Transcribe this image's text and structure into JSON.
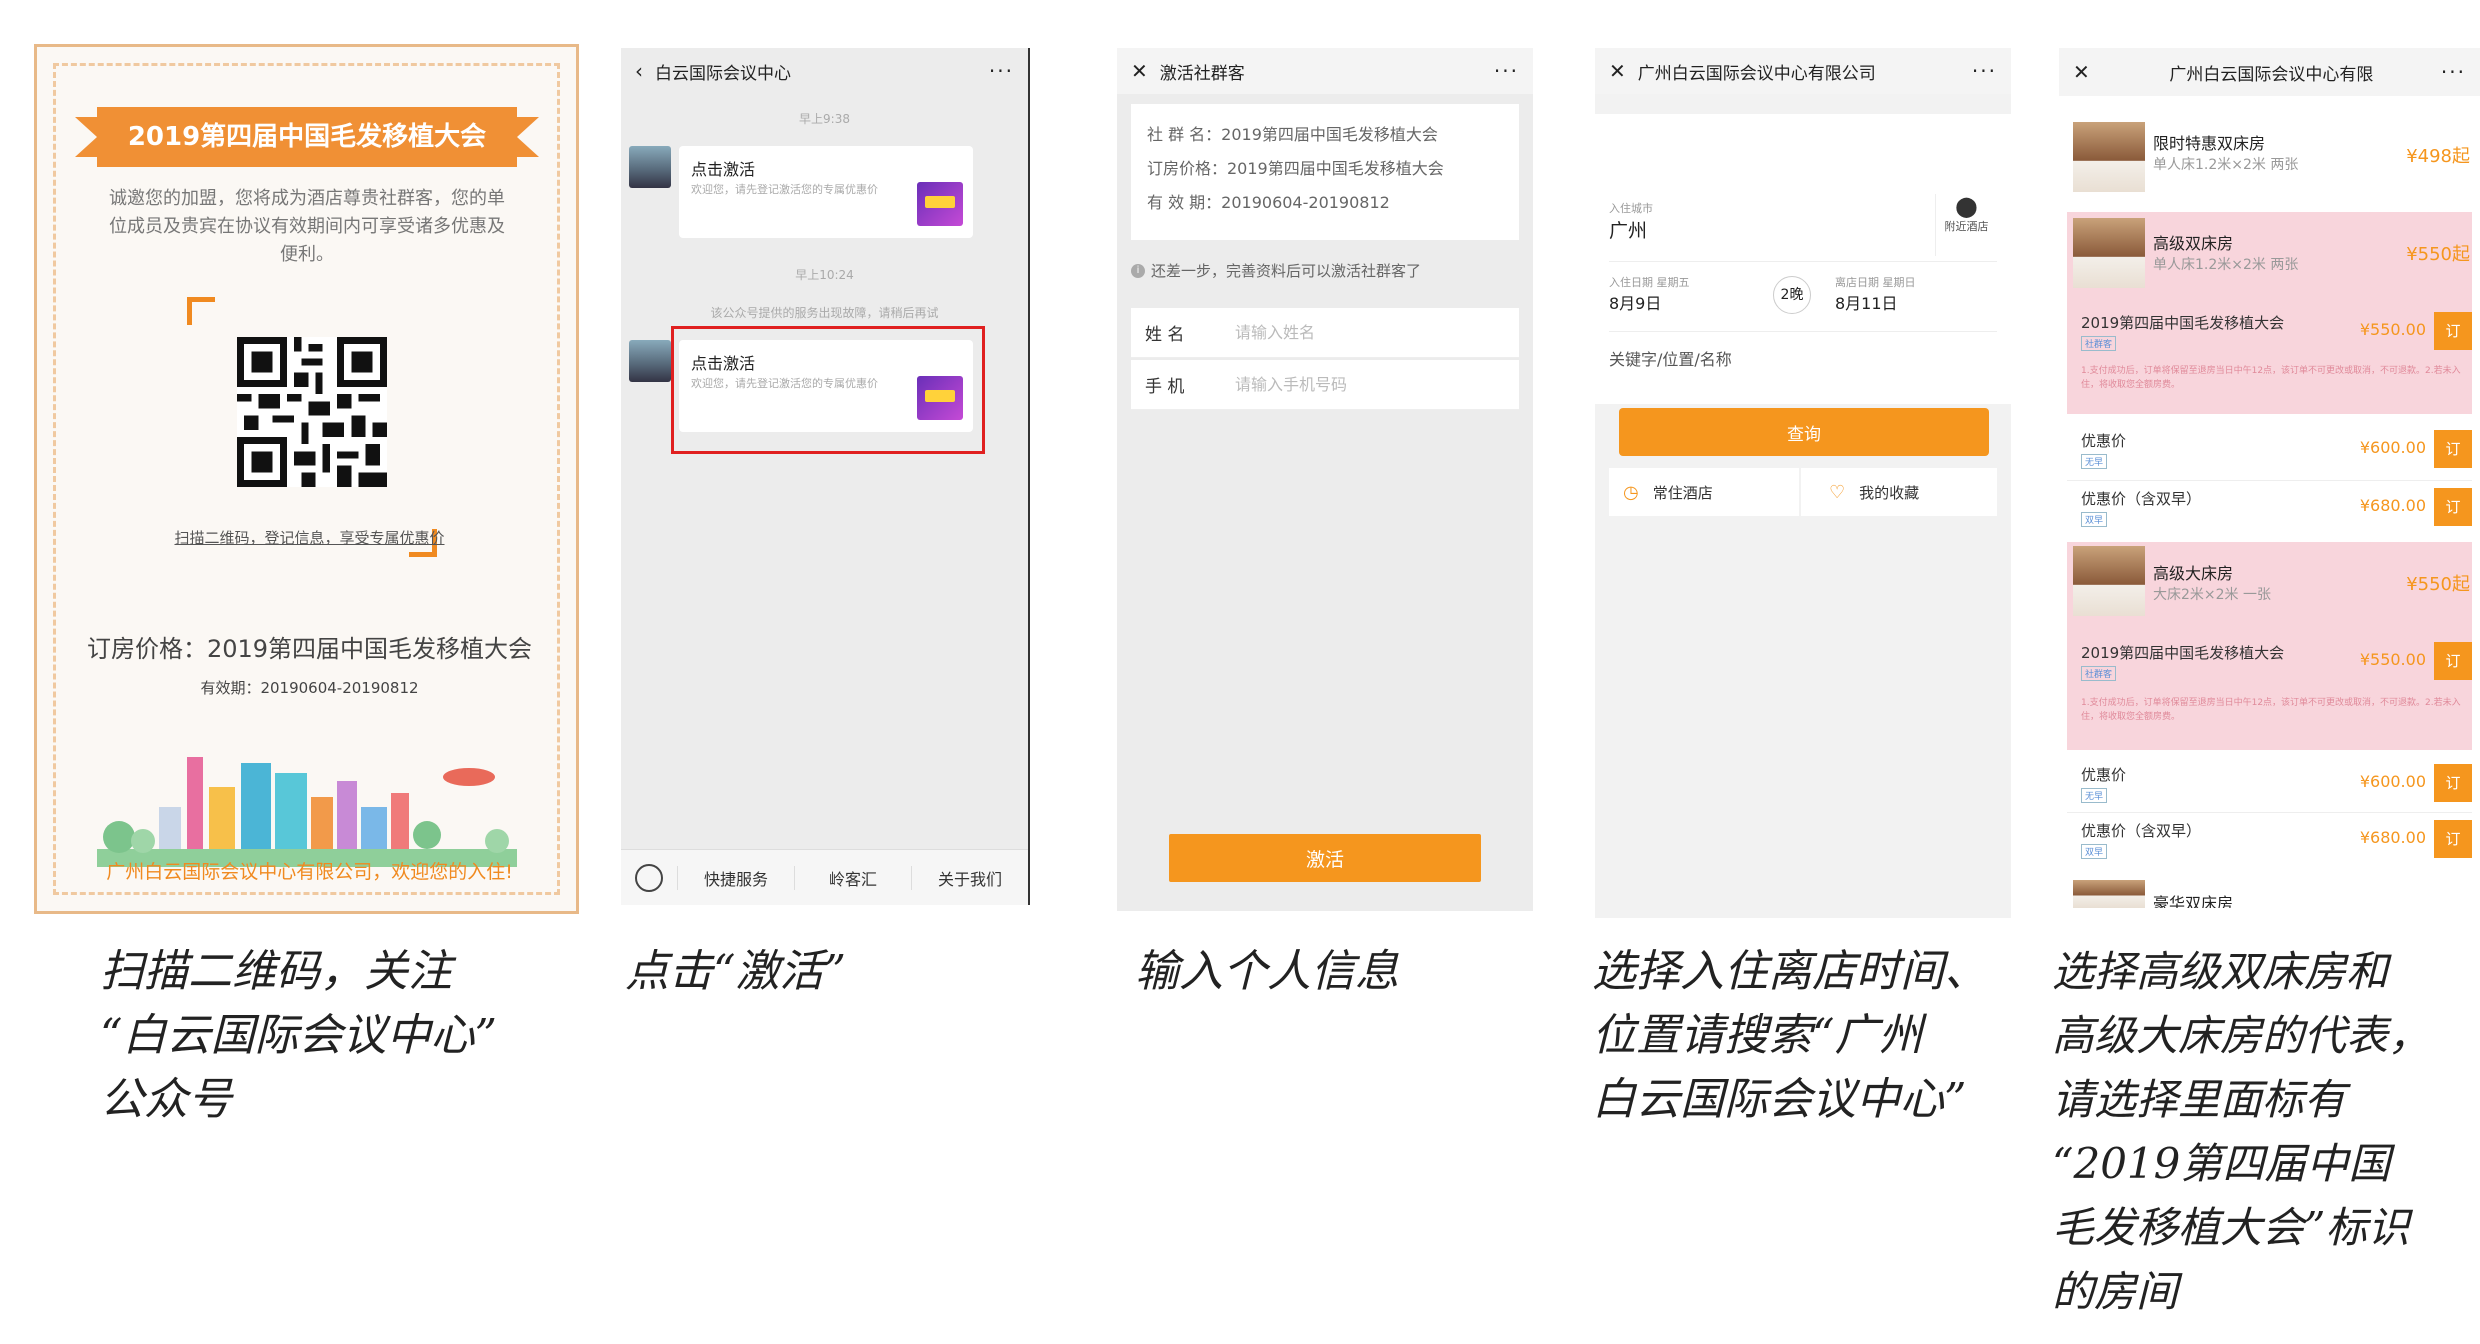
{
  "colors": {
    "accent": "#f5961e",
    "poster_orange": "#f08a20",
    "highlight_red": "#e02020",
    "pink_bg": "#f8d5dc"
  },
  "poster": {
    "banner": "2019第四届中国毛发移植大会",
    "intro": "诚邀您的加盟，您将成为酒店尊贵社群客，您的单位成员及贵宾在协议有效期间内可享受诸多优惠及便利。",
    "scan_tip": "扫描二维码，登记信息，享受专属优惠价",
    "price": "订房价格：2019第四届中国毛发移植大会",
    "validity": "有效期：20190604-20190812",
    "welcome": "广州白云国际会议中心有限公司，欢迎您的入住!"
  },
  "chat": {
    "title": "白云国际会议中心",
    "back_icon": "chevron-left-icon",
    "more": "···",
    "time1": "早上9:38",
    "time2": "早上10:24",
    "card_title": "点击激活",
    "card1_desc": "欢迎您，请先登记激活您的专属优惠价",
    "card2_desc": "欢迎您，请先登记激活您的专属优惠价",
    "notice": "该公众号提供的服务出现故障，请稍后再试",
    "menu": [
      "快捷服务",
      "岭客汇",
      "关于我们"
    ]
  },
  "activate": {
    "title": "激活社群客",
    "group_line": "社 群 名：2019第四届中国毛发移植大会",
    "price_line": "订房价格：2019第四届中国毛发移植大会",
    "validity_line": "有 效 期：20190604-20190812",
    "hint": "还差一步，完善资料后可以激活社群客了",
    "name_label": "姓 名",
    "name_placeholder": "请输入姓名",
    "phone_label": "手 机",
    "phone_placeholder": "请输入手机号码",
    "button": "激活"
  },
  "search": {
    "title": "广州白云国际会议中心有限公司",
    "city_label": "入住城市",
    "city": "广州",
    "nearby": "附近酒店",
    "checkin_label": "入住日期 星期五",
    "checkin": "8月9日",
    "nights": "2晚",
    "checkout_label": "离店日期 星期日",
    "checkout": "8月11日",
    "keyword_placeholder": "关键字/位置/名称",
    "query_button": "查询",
    "frequent": "常住酒店",
    "favorites": "我的收藏"
  },
  "rooms": {
    "title": "广州白云国际会议中心有限",
    "items": [
      {
        "name": "限时特惠双床房",
        "desc": "单人床1.2米×2米 两张",
        "price": "¥498起"
      },
      {
        "name": "高级双床房",
        "desc": "单人床1.2米×2米 两张",
        "price": "¥550起"
      },
      {
        "name": "高级大床房",
        "desc": "大床2米×2米 一张",
        "price": "¥550起"
      }
    ],
    "rates": {
      "conference": {
        "name": "2019第四届中国毛发移植大会",
        "price": "¥550.00",
        "tag": "社群客"
      },
      "discount": {
        "name": "优惠价",
        "price": "¥600.00",
        "tag": "无早"
      },
      "breakfast": {
        "name": "优惠价（含双早）",
        "price": "¥680.00",
        "tag": "双早"
      }
    },
    "terms": "1.支付成功后，订单将保留至退房当日中午12点，该订单不可更改或取消，不可退款。2.若未入住，将收取您全额房费。",
    "book": "订",
    "partial_room": "豪华双床房"
  },
  "captions": {
    "c1": [
      "扫描二维码，关注",
      "“白云国际会议中心”",
      "公众号"
    ],
    "c2": [
      "点击“激活”"
    ],
    "c3": [
      "输入个人信息"
    ],
    "c4": [
      "选择入住离店时间、",
      "位置请搜索“广州",
      "白云国际会议中心”"
    ],
    "c5": [
      "选择高级双床房和",
      "高级大床房的代表，",
      "请选择里面标有",
      "“2019第四届中国",
      "毛发移植大会”标识",
      "的房间"
    ]
  }
}
